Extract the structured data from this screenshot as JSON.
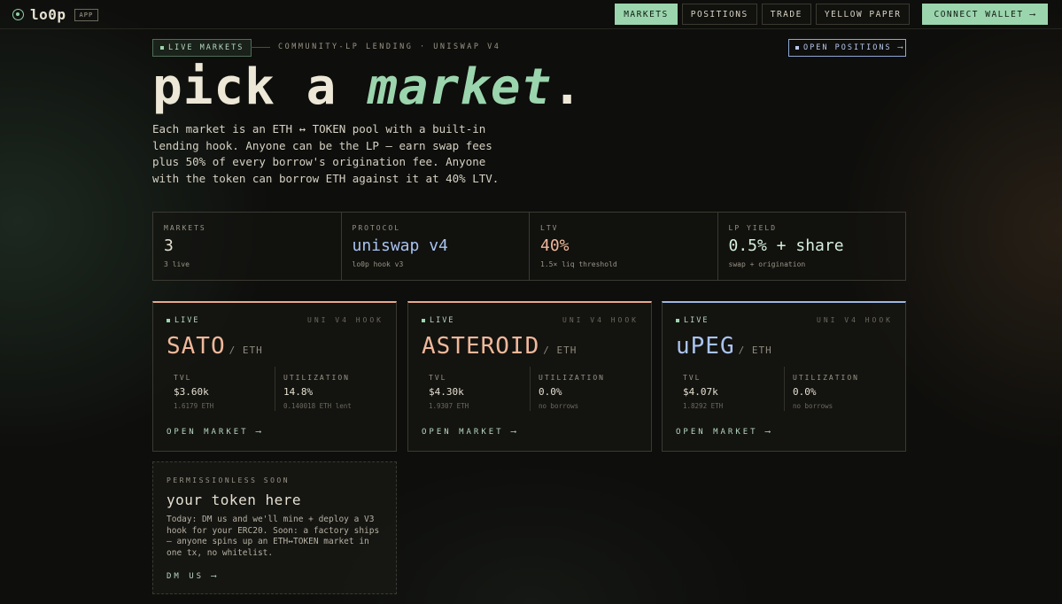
{
  "brand": {
    "name": "lo0p",
    "badge": "APP",
    "accent": "#9bd5ad"
  },
  "nav": {
    "markets": "MARKETS",
    "positions": "POSITIONS",
    "trade": "TRADE",
    "yellow_paper": "YELLOW PAPER",
    "connect": "CONNECT WALLET ⟶"
  },
  "hero": {
    "pill": "LIVE MARKETS",
    "subtitle": "COMMUNITY-LP LENDING · UNISWAP V4",
    "open_positions": "OPEN POSITIONS ⟶",
    "title_a": "pick a ",
    "title_b": "market",
    "title_c": ".",
    "intro": "Each market is an ETH ↔ TOKEN pool with a built-in lending hook. Anyone can be the LP — earn swap fees plus 50% of every borrow's origination fee. Anyone with the token can borrow ETH against it at 40% LTV."
  },
  "stats": [
    {
      "label": "MARKETS",
      "value": "3",
      "note": "3 live"
    },
    {
      "label": "PROTOCOL",
      "value": "uniswap v4",
      "note": "lo0p hook v3"
    },
    {
      "label": "LTV",
      "value": "40%",
      "note": "1.5× liq threshold"
    },
    {
      "label": "LP YIELD",
      "value": "0.5% + share",
      "note": "swap + origination"
    }
  ],
  "markets": [
    {
      "live": "LIVE",
      "hook": "UNI V4 HOOK",
      "name": "SATO",
      "pair": "/ ETH",
      "tvl_label": "TVL",
      "tvl": "$3.60k",
      "tvl_note": "1.6179 ETH",
      "util_label": "UTILIZATION",
      "util": "14.8%",
      "util_note": "0.140018 ETH lent",
      "link": "OPEN MARKET ⟶"
    },
    {
      "live": "LIVE",
      "hook": "UNI V4 HOOK",
      "name": "ASTEROID",
      "pair": "/ ETH",
      "tvl_label": "TVL",
      "tvl": "$4.30k",
      "tvl_note": "1.9307 ETH",
      "util_label": "UTILIZATION",
      "util": "0.0%",
      "util_note": "no borrows",
      "link": "OPEN MARKET ⟶"
    },
    {
      "live": "LIVE",
      "hook": "UNI V4 HOOK",
      "name": "uPEG",
      "pair": "/ ETH",
      "tvl_label": "TVL",
      "tvl": "$4.07k",
      "tvl_note": "1.8292 ETH",
      "util_label": "UTILIZATION",
      "util": "0.0%",
      "util_note": "no borrows",
      "link": "OPEN MARKET ⟶"
    }
  ],
  "token_card": {
    "label": "PERMISSIONLESS SOON",
    "title": "your token here",
    "desc": "Today: DM us and we'll mine + deploy a V3 hook for your ERC20. Soon: a factory ships — anyone spins up an ETH↔TOKEN market in one tx, no whitelist.",
    "link": "DM US ⟶"
  }
}
